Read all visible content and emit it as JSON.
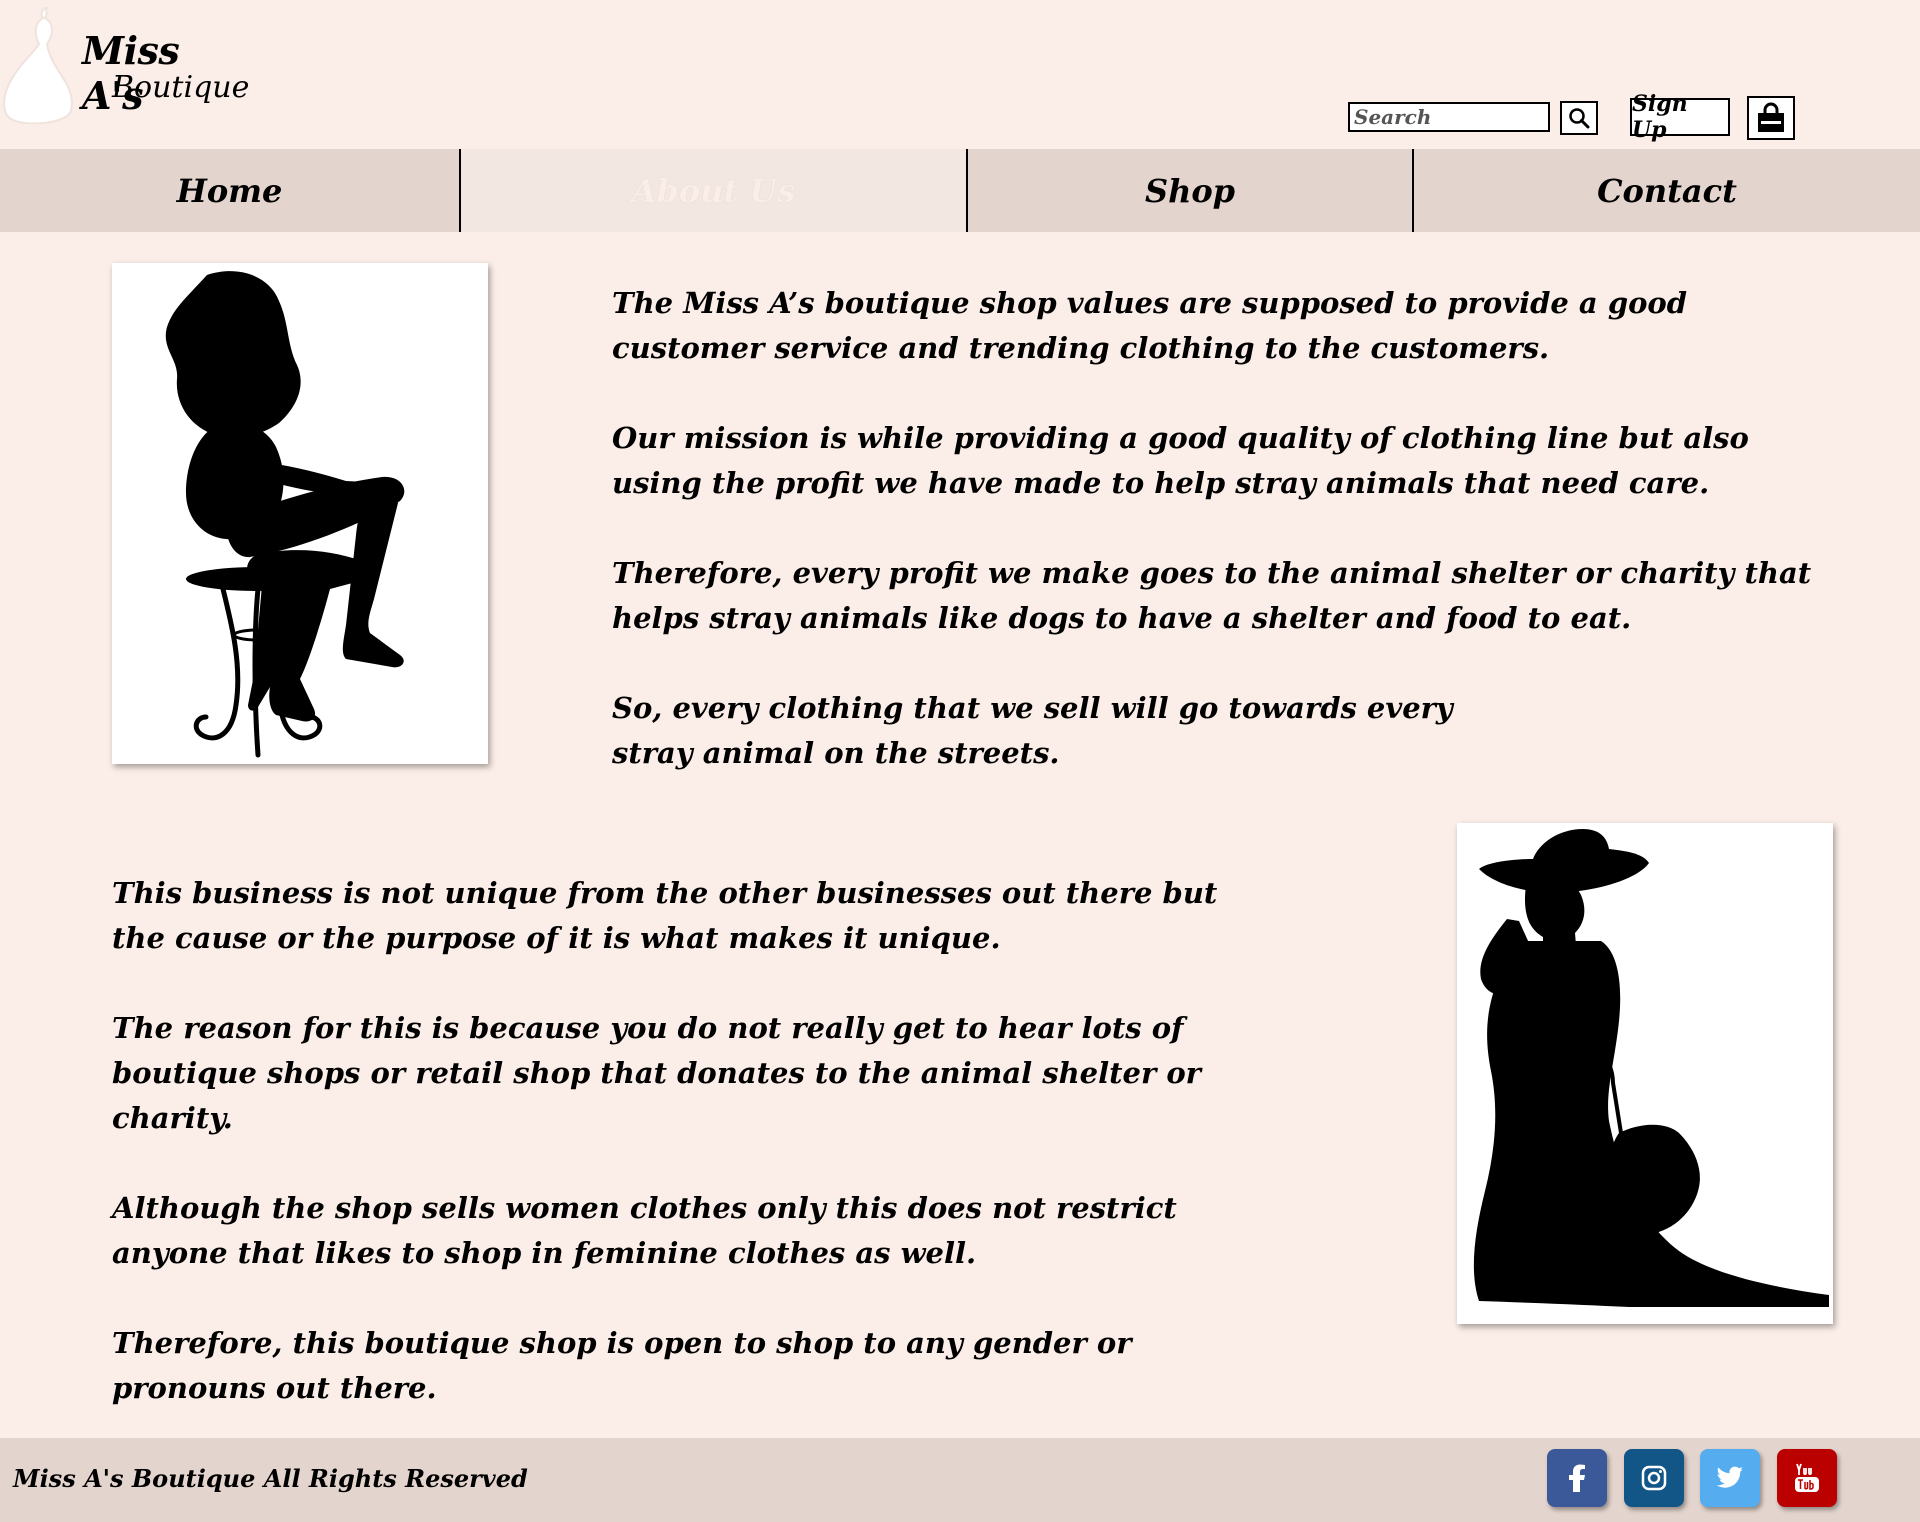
{
  "header": {
    "logo_title": "Miss A's",
    "logo_subtitle": "Boutique",
    "search_placeholder": "Search",
    "search_icon": "magnifier-icon",
    "signup_label": "Sign Up",
    "cart_icon": "shopping-bag-icon"
  },
  "nav": {
    "items": [
      {
        "label": "Home",
        "active": false
      },
      {
        "label": "About Us",
        "active": true
      },
      {
        "label": "Shop",
        "active": false
      },
      {
        "label": "Contact",
        "active": false
      }
    ]
  },
  "about": {
    "image_1": "silhouette-woman-on-stool",
    "section_1": [
      "The Miss A’s boutique shop values are supposed to provide a good customer service and trending clothing to the customers.",
      "Our mission is while providing a good quality of clothing line but also using the profit we have made to help stray animals that need care.",
      "Therefore, every profit we make goes to the animal shelter or charity that helps stray animals like dogs to have a shelter and food to eat.",
      "So, every clothing that we sell will go towards every stray animal on the streets."
    ],
    "section_2": [
      "This business is not unique from the other businesses out there but the cause or the purpose of it is what makes it unique.",
      "The reason for this is because you do not really get to hear lots of boutique shops or retail shop that donates to the animal shelter or charity.",
      "Although the shop sells women clothes only this does not restrict anyone that likes to shop in feminine clothes as well.",
      "Therefore, this boutique shop is open to shop to any gender or pronouns out there."
    ],
    "image_2": "silhouette-lady-with-hat-and-parasol"
  },
  "footer": {
    "copyright": "Miss A's Boutique All Rights Reserved",
    "social": [
      {
        "icon": "facebook-icon",
        "color": "#3b5998"
      },
      {
        "icon": "instagram-icon",
        "color": "#125688"
      },
      {
        "icon": "twitter-icon",
        "color": "#55acee"
      },
      {
        "icon": "youtube-icon",
        "color": "#bb0000"
      }
    ]
  },
  "colors": {
    "background": "#fbede7",
    "nav_background": "#e3d4cd",
    "nav_active": "#f2e8e1"
  }
}
